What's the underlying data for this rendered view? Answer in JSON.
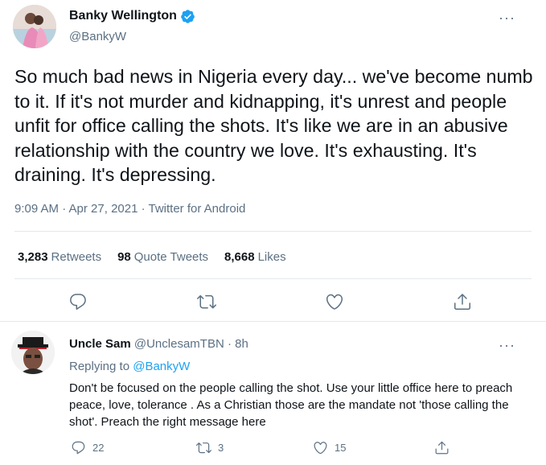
{
  "tweet": {
    "author_name": "Banky Wellington",
    "author_handle": "@BankyW",
    "text": "So much bad news in Nigeria every day... we've become numb to it. If it's not murder and kidnapping, it's unrest and people unfit for office calling the shots. It's like we are in an abusive relationship with the country we love. It's exhausting. It's draining. It's depressing.",
    "meta": "9:09 AM · Apr 27, 2021 · Twitter for Android",
    "retweets_count": "3,283",
    "retweets_label": "Retweets",
    "quotes_count": "98",
    "quotes_label": "Quote Tweets",
    "likes_count": "8,668",
    "likes_label": "Likes",
    "more": "···"
  },
  "reply": {
    "author_name": "Uncle Sam",
    "author_handle": "@UnclesamTBN",
    "time": " · 8h",
    "replying_prefix": "Replying to ",
    "replying_to": "@BankyW",
    "text": "Don't be focused on the people calling the shot. Use your little office here to preach peace, love, tolerance . As a Christian those are the mandate not 'those calling the shot'. Preach the right message here",
    "reply_count": "22",
    "retweet_count": "3",
    "like_count": "15",
    "more": "···"
  },
  "colors": {
    "accent": "#1da1f2",
    "secondary_text": "#5b7083",
    "primary_text": "#0f1419",
    "border": "#e1e8ed"
  },
  "icons": [
    "verified-badge-icon",
    "reply-icon",
    "retweet-icon",
    "like-icon",
    "share-icon",
    "more-icon"
  ]
}
